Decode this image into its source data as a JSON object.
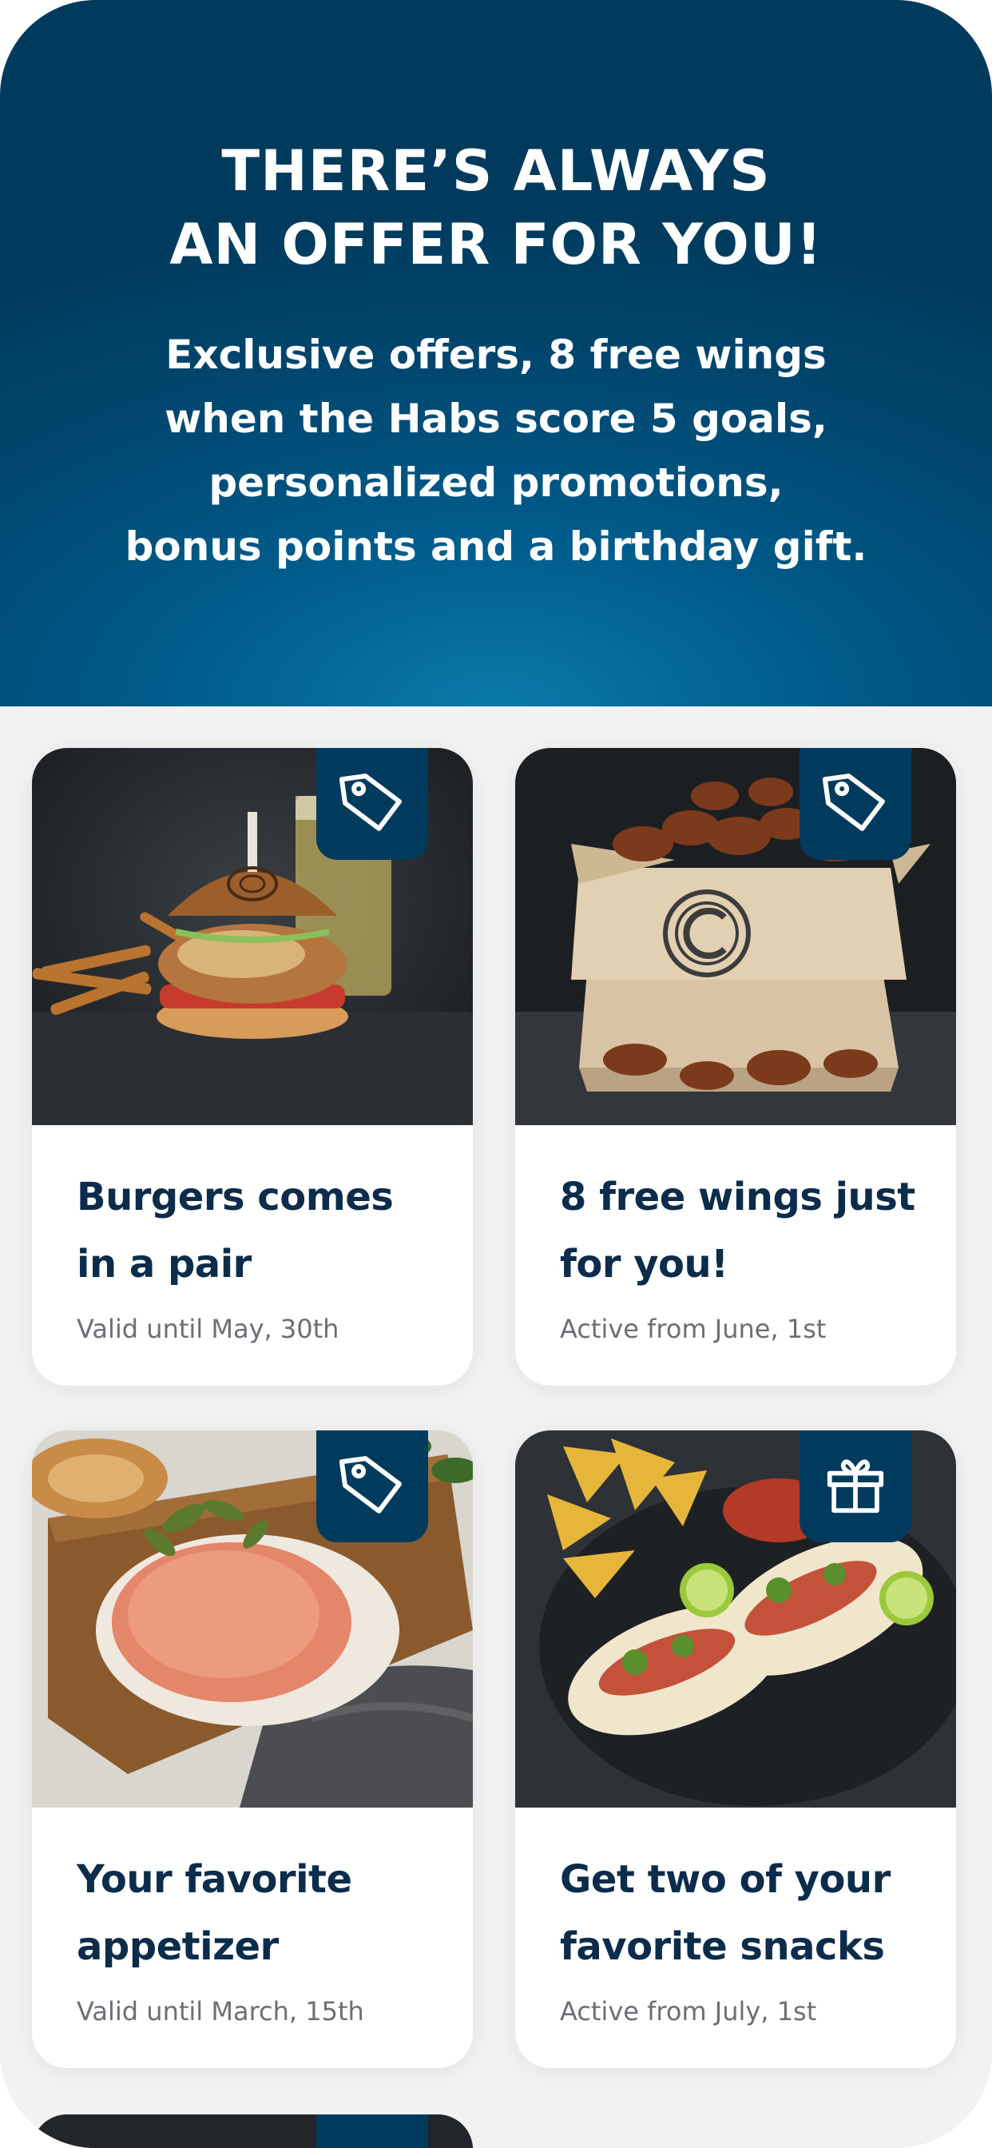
{
  "hero": {
    "title_line1": "THERE’S ALWAYS",
    "title_line2": "AN OFFER FOR YOU!",
    "subtitle_line1": "Exclusive offers, 8 free wings",
    "subtitle_line2": "when the Habs score 5 goals,",
    "subtitle_line3": "personalized promotions,",
    "subtitle_line4": "bonus points and a birthday gift."
  },
  "colors": {
    "brand_navy": "#003b5e",
    "title_text": "#0b2c4a",
    "meta_text": "#6b6f74",
    "background": "#f2f2f2"
  },
  "offers": [
    {
      "title_line1": "Burgers comes",
      "title_line2": "in a pair",
      "meta": "Valid until May, 30th",
      "badge_icon": "tag-icon",
      "image": "burger-photo"
    },
    {
      "title_line1": "8 free wings just",
      "title_line2": "for you!",
      "meta": "Active from June, 1st",
      "badge_icon": "tag-icon",
      "image": "wings-photo"
    },
    {
      "title_line1": "Your favorite",
      "title_line2": "appetizer",
      "meta": "Valid until March, 15th",
      "badge_icon": "tag-icon",
      "image": "tartare-photo"
    },
    {
      "title_line1": "Get two of your",
      "title_line2": "favorite snacks",
      "meta": "Active from July, 1st",
      "badge_icon": "gift-icon",
      "image": "tacos-photo"
    }
  ]
}
